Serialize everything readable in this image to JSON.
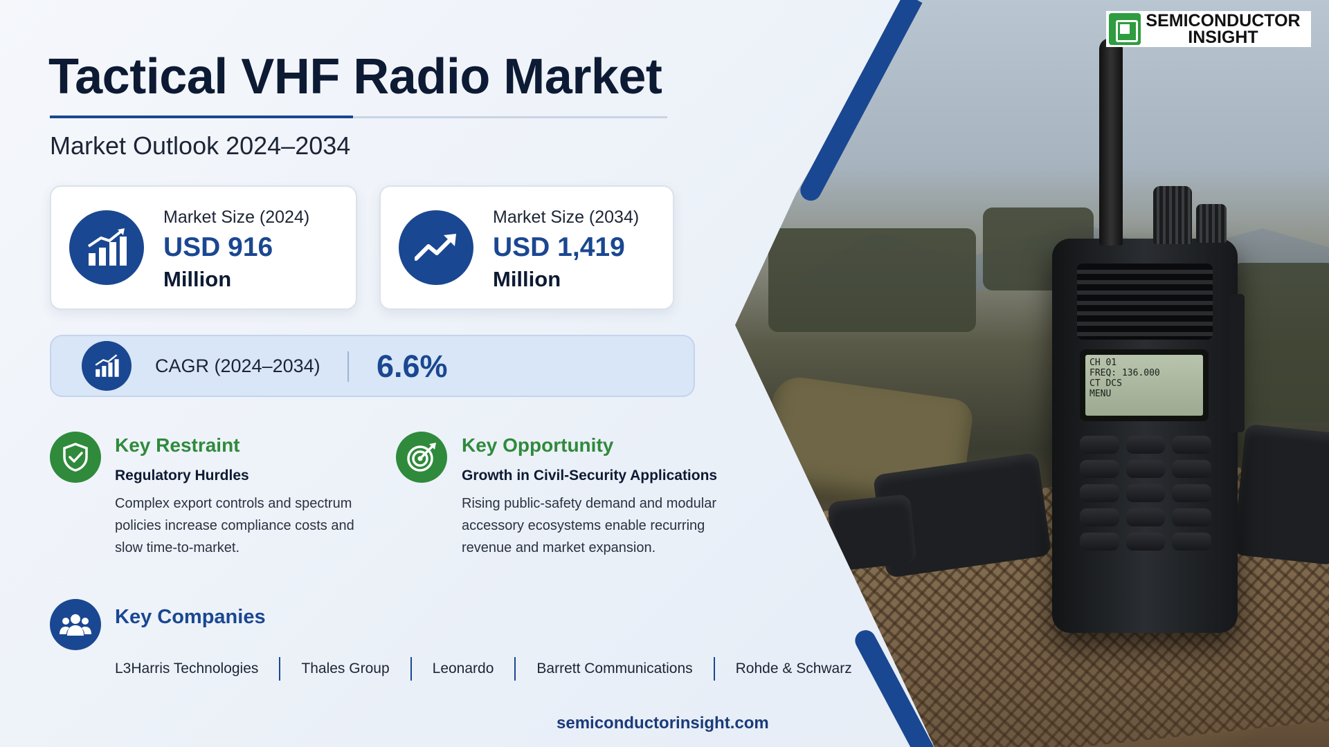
{
  "title": "Tactical VHF Radio Market",
  "subtitle": "Market Outlook 2024–2034",
  "logo": {
    "line1": "SEMICONDUCTOR",
    "line2": "INSIGHT",
    "brand_color": "#2e9c3f"
  },
  "market_size_2024": {
    "label": "Market Size (2024)",
    "value": "USD 916",
    "unit": "Million",
    "icon": "bar-chart-growth-icon"
  },
  "market_size_2034": {
    "label": "Market Size (2034)",
    "value": "USD 1,419",
    "unit": "Million",
    "icon": "trend-up-arrow-icon"
  },
  "cagr": {
    "label": "CAGR (2024–2034)",
    "value": "6.6%",
    "icon": "bar-chart-growth-icon"
  },
  "key_restraint": {
    "heading": "Key Restraint",
    "subheading": "Regulatory Hurdles",
    "body": "Complex export controls and spectrum policies increase compliance costs and slow time-to-market.",
    "icon": "shield-check-icon"
  },
  "key_opportunity": {
    "heading": "Key Opportunity",
    "subheading": "Growth in Civil-Security Applications",
    "body": "Rising public-safety demand and modular accessory ecosystems enable recurring revenue and market expansion.",
    "icon": "target-icon"
  },
  "key_companies": {
    "heading": "Key Companies",
    "icon": "people-group-icon",
    "items": [
      "L3Harris Technologies",
      "Thales Group",
      "Leonardo",
      "Barrett Communications",
      "Rohde & Schwarz"
    ]
  },
  "radio_screen": {
    "line1": "CH 01",
    "line2": "FREQ: 136.000",
    "line3": "CT DCS",
    "line4": "MENU"
  },
  "website": "semiconductorinsight.com",
  "colors": {
    "primary_blue": "#1a4791",
    "accent_green": "#2f8a3b",
    "title_dark": "#0d1a33"
  }
}
